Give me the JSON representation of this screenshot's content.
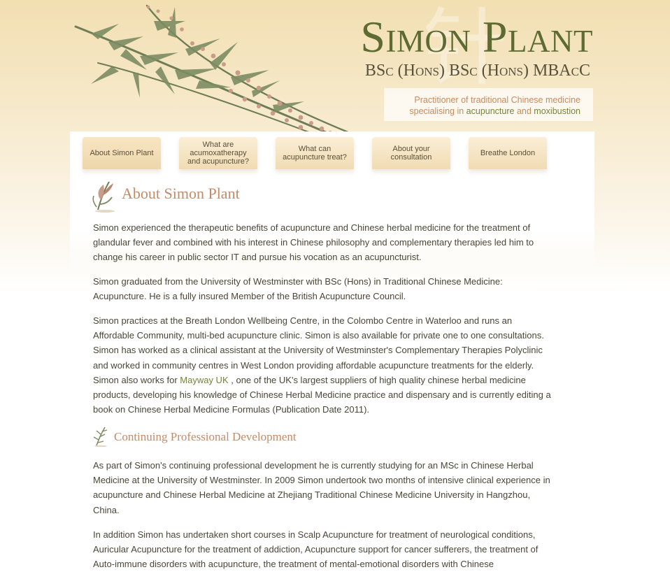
{
  "header": {
    "site_title": "Simon Plant",
    "credentials": "BSc (Hons) BSc (Hons) MBAcC",
    "tagline": {
      "line1": "Practitioner of traditional Chinese medicine",
      "line2_prefix": "specialising in ",
      "link1": "acupuncture",
      "and": " and ",
      "link2": "moxibustion"
    }
  },
  "nav": {
    "items": [
      {
        "label": "About Simon Plant"
      },
      {
        "label": "What are acumoxatherapy and acupuncture?"
      },
      {
        "label": "What can acupuncture treat?"
      },
      {
        "label": "About your consultation"
      },
      {
        "label": "Breathe London"
      }
    ]
  },
  "main": {
    "heading": "About Simon Plant",
    "paragraphs": [
      "Simon experienced the therapeutic benefits of acupuncture and Chinese herbal medicine for the treatment of glandular fever and combined with his interest in Chinese philosophy and complementary therapies led him to change his career in public sector IT and pursue his vocation as an acupuncturist.",
      "Simon graduated from the University of Westminster with BSc (Hons) in Traditional Chinese Medicine: Acupuncture. He is a fully insured Member of the British Acupuncture Council."
    ],
    "para3": {
      "before": "Simon practices at the Breath London Wellbeing Centre, in the Colombo Centre in Waterloo and runs an Affordable Community, multi-bed acupuncture clinic. Simon is also available for private one to one consultations. Simon has worked as a clinical assistant at the University of Westminster's Complementary Therapies Polyclinic and worked in community centres in West London providing affordable acupuncture treatments for the elderly. Simon also works for ",
      "link": "Mayway UK",
      "after": " , one of the UK's largest suppliers of high quality chinese herbal medicine products, developing his knowledge of Chinese Herbal Medicine practice and dispensary and is currently editing a book on Chinese Herbal Medicine Formulas (Publication Date 2011)."
    },
    "subheading": "Continuing Professional Development",
    "paragraphs2": [
      "As part of Simon's continuing professional development he is currently studying for an MSc in Chinese Herbal Medicine at the University of Westminster. In 2009 Simon undertook two months of intensive clinical experience in acupuncture and Chinese Herbal Medicine at Zhejiang Traditional Chinese Medicine University in Hangzhou, China.",
      "In addition Simon has undertaken short courses in Scalp Acupuncture for treatment of neurological conditions, Auricular Acupuncture for the treatment of addiction, Acupuncture support for cancer sufferers, the treatment of Auto-immune disorders with acupuncture, the treatment of mental-emotional disorders with Chinese"
    ]
  },
  "icons": {
    "plant_art": "herb-branch-illustration",
    "heading_icon": "herb-sprig-icon",
    "subheading_icon": "leaf-sprig-icon"
  },
  "colors": {
    "title_green": "#5d6a32",
    "heading_terracotta": "#c38b68",
    "link_green": "#73853a",
    "nav_tab": "#f0dbb3"
  }
}
